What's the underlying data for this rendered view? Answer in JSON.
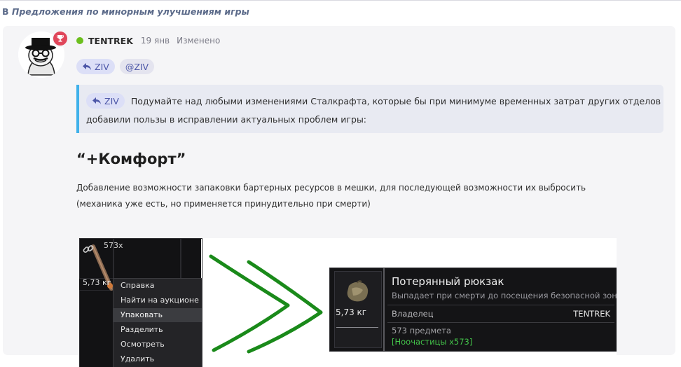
{
  "breadcrumb": {
    "prefix": "В",
    "topic": "Предложения по минорным улучшениям игры"
  },
  "post": {
    "author": "TENTREK",
    "date": "19 янв",
    "edited": "Изменено",
    "reply_chip": "ZIV",
    "mention_chip": "@ZIV",
    "quote": {
      "chip": "ZIV",
      "line1": "Подумайте над любыми изменениями Сталкрафта, которые бы при минимуме временных затрат других отделов",
      "line2": "добавили пользы в исправлении актуальных проблем игры:"
    },
    "heading": "“+Комфорт”",
    "para1": "Добавление возможности запаковки бартерных ресурсов в мешки, для последующей возможности их выбросить",
    "para2": "(механика уже есть, но применяется принудительно при смерти)"
  },
  "screenshot": {
    "inventory": {
      "count": "573x",
      "weight": "5,73 кг",
      "menu": [
        "Справка",
        "Найти на аукционе",
        "Упаковать",
        "Разделить",
        "Осмотреть",
        "Удалить"
      ],
      "highlighted_index": 2
    },
    "tooltip": {
      "title": "Потерянный рюкзак",
      "subtitle": "Выпадает при смерти до посещения безопасной зоны",
      "weight": "5,73 кг",
      "owner_label": "Владелец",
      "owner_value": "TENTREK",
      "items": "573 предмета",
      "contents": "[Ноочастицы x573]"
    }
  },
  "colors": {
    "accent": "#4d57a8",
    "quote_border": "#3fb1ea",
    "online": "#6cbf1e",
    "badge": "#e0465a",
    "arrow": "#1a8a1a",
    "tooltip_green": "#43c44a"
  }
}
